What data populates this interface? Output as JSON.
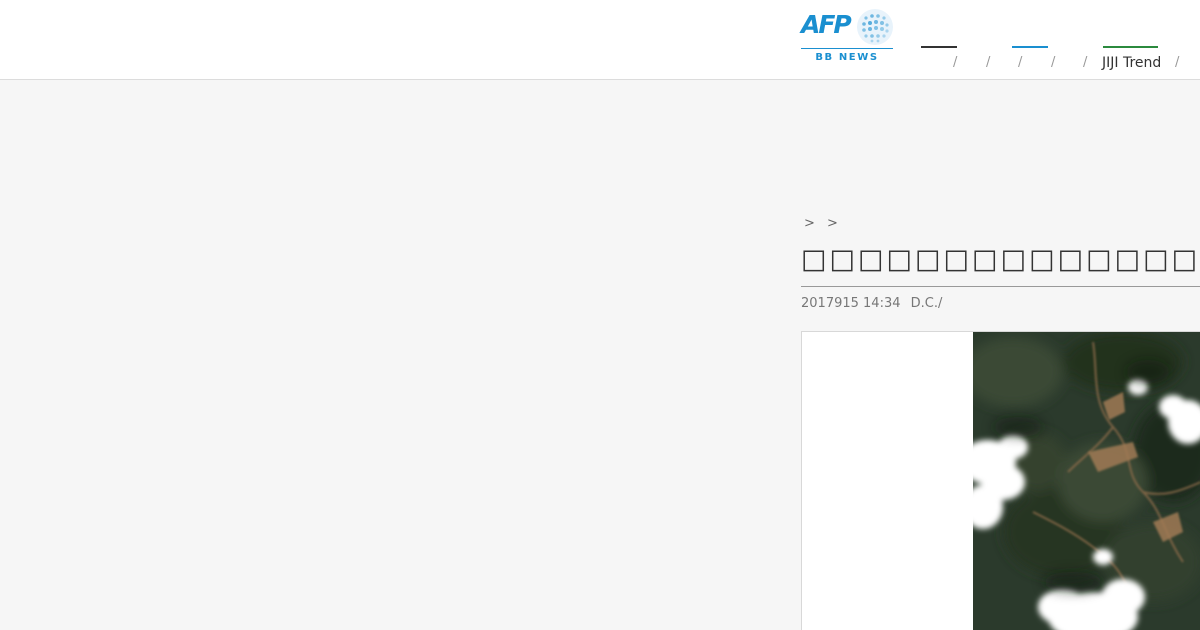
{
  "header": {
    "logo": {
      "brand": "AFP",
      "sub": "BB NEWS"
    },
    "nav": {
      "items": [
        {
          "label": ""
        },
        {
          "label": ""
        },
        {
          "label": ""
        },
        {
          "label": ""
        },
        {
          "label": ""
        },
        {
          "label": "JIJI Trend"
        }
      ],
      "separator": "/",
      "accent_colors": [
        "#333333",
        "#1a8fd0",
        "#2b8a3e"
      ]
    }
  },
  "article": {
    "breadcrumb": [
      ">",
      ">"
    ],
    "title": "□□□□□□□□□□□□□□□□ □□□□□□□□",
    "date": "2017915 14:34",
    "location": "D.C./",
    "photo_alt": "satellite-image-landslide"
  },
  "colors": {
    "brand": "#1a8fd0",
    "background": "#f6f6f6",
    "header": "#ffffff"
  }
}
